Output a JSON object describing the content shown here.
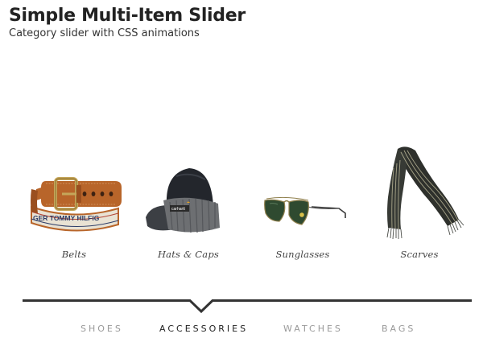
{
  "header": {
    "title": "Simple Multi-Item Slider",
    "subtitle": "Category slider with CSS animations"
  },
  "slider": {
    "items": [
      {
        "label": "Belts",
        "icon": "belt-icon"
      },
      {
        "label": "Hats & Caps",
        "icon": "hat-icon"
      },
      {
        "label": "Sunglasses",
        "icon": "sunglasses-icon"
      },
      {
        "label": "Scarves",
        "icon": "scarf-icon"
      }
    ],
    "belt_strap_text": "GER  TOMMY  HILFIG",
    "hat_badge_text": "carhartt"
  },
  "tabs": [
    {
      "label": "SHOES",
      "active": false
    },
    {
      "label": "ACCESSORIES",
      "active": true
    },
    {
      "label": "WATCHES",
      "active": false
    },
    {
      "label": "BAGS",
      "active": false
    }
  ],
  "colors": {
    "divider": "#333333",
    "tab_active": "#222222",
    "tab_inactive": "#9a9a9a"
  }
}
